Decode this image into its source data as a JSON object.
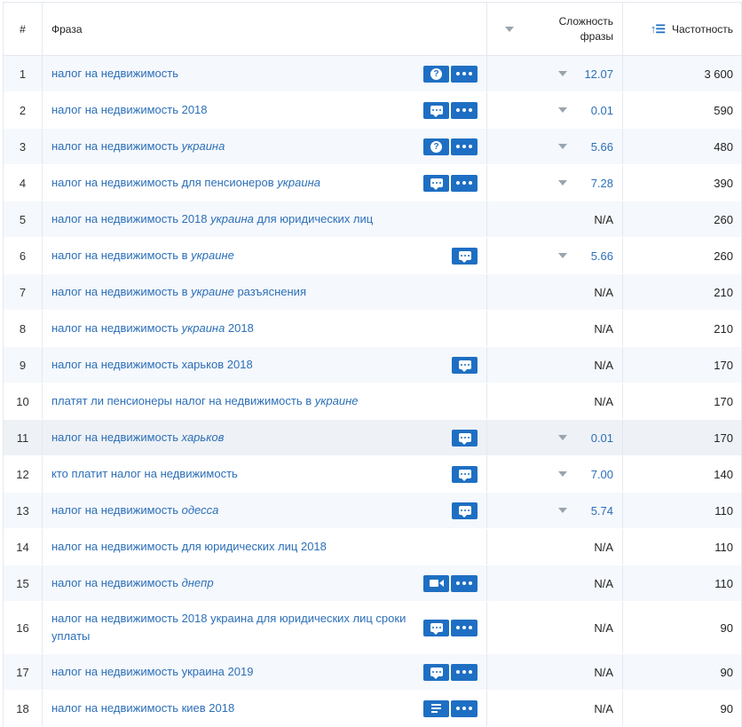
{
  "header": {
    "num": "#",
    "phrase": "Фраза",
    "difficulty_line1": "Сложность",
    "difficulty_line2": "фразы",
    "frequency": "Частотность"
  },
  "rows": [
    {
      "num": "1",
      "phrase": [
        {
          "t": "налог на недвижимость",
          "i": false
        }
      ],
      "buttons": [
        "question",
        "more"
      ],
      "difficulty": "12.07",
      "has_arrow": true,
      "frequency": "3 600"
    },
    {
      "num": "2",
      "phrase": [
        {
          "t": "налог на недвижимость 2018",
          "i": false
        }
      ],
      "buttons": [
        "chat",
        "more"
      ],
      "difficulty": "0.01",
      "has_arrow": true,
      "frequency": "590"
    },
    {
      "num": "3",
      "phrase": [
        {
          "t": "налог на недвижимость ",
          "i": false
        },
        {
          "t": "украина",
          "i": true
        }
      ],
      "buttons": [
        "question",
        "more"
      ],
      "difficulty": "5.66",
      "has_arrow": true,
      "frequency": "480"
    },
    {
      "num": "4",
      "phrase": [
        {
          "t": "налог на недвижимость для пенсионеров ",
          "i": false
        },
        {
          "t": "украина",
          "i": true
        }
      ],
      "buttons": [
        "chat",
        "more"
      ],
      "difficulty": "7.28",
      "has_arrow": true,
      "frequency": "390"
    },
    {
      "num": "5",
      "phrase": [
        {
          "t": "налог на недвижимость 2018 ",
          "i": false
        },
        {
          "t": "украина",
          "i": true
        },
        {
          "t": " для юридических лиц",
          "i": false
        }
      ],
      "buttons": [],
      "difficulty": "N/A",
      "has_arrow": false,
      "frequency": "260"
    },
    {
      "num": "6",
      "phrase": [
        {
          "t": "налог на недвижимость в ",
          "i": false
        },
        {
          "t": "украине",
          "i": true
        }
      ],
      "buttons": [
        "chat"
      ],
      "difficulty": "5.66",
      "has_arrow": true,
      "frequency": "260"
    },
    {
      "num": "7",
      "phrase": [
        {
          "t": "налог на недвижимость в ",
          "i": false
        },
        {
          "t": "украине",
          "i": true
        },
        {
          "t": " разъяснения",
          "i": false
        }
      ],
      "buttons": [],
      "difficulty": "N/A",
      "has_arrow": false,
      "frequency": "210"
    },
    {
      "num": "8",
      "phrase": [
        {
          "t": "налог на недвижимость ",
          "i": false
        },
        {
          "t": "украина",
          "i": true
        },
        {
          "t": " 2018",
          "i": false
        }
      ],
      "buttons": [],
      "difficulty": "N/A",
      "has_arrow": false,
      "frequency": "210"
    },
    {
      "num": "9",
      "phrase": [
        {
          "t": "налог на недвижимость харьков 2018",
          "i": false
        }
      ],
      "buttons": [
        "chat"
      ],
      "difficulty": "N/A",
      "has_arrow": false,
      "frequency": "170"
    },
    {
      "num": "10",
      "phrase": [
        {
          "t": "платят ли пенсионеры налог на недвижимость в ",
          "i": false
        },
        {
          "t": "украине",
          "i": true
        }
      ],
      "buttons": [],
      "difficulty": "N/A",
      "has_arrow": false,
      "frequency": "170"
    },
    {
      "num": "11",
      "phrase": [
        {
          "t": "налог на недвижимость ",
          "i": false
        },
        {
          "t": "харьков",
          "i": true
        }
      ],
      "buttons": [
        "chat"
      ],
      "difficulty": "0.01",
      "has_arrow": true,
      "frequency": "170"
    },
    {
      "num": "12",
      "phrase": [
        {
          "t": "кто платит налог на недвижимость",
          "i": false
        }
      ],
      "buttons": [
        "chat"
      ],
      "difficulty": "7.00",
      "has_arrow": true,
      "frequency": "140"
    },
    {
      "num": "13",
      "phrase": [
        {
          "t": "налог на недвижимость ",
          "i": false
        },
        {
          "t": "одесса",
          "i": true
        }
      ],
      "buttons": [
        "chat"
      ],
      "difficulty": "5.74",
      "has_arrow": true,
      "frequency": "110"
    },
    {
      "num": "14",
      "phrase": [
        {
          "t": "налог на недвижимость для юридических лиц 2018",
          "i": false
        }
      ],
      "buttons": [],
      "difficulty": "N/A",
      "has_arrow": false,
      "frequency": "110"
    },
    {
      "num": "15",
      "phrase": [
        {
          "t": "налог на недвижимость ",
          "i": false
        },
        {
          "t": "днепр",
          "i": true
        }
      ],
      "buttons": [
        "video",
        "more"
      ],
      "difficulty": "N/A",
      "has_arrow": false,
      "frequency": "110"
    },
    {
      "num": "16",
      "phrase": [
        {
          "t": "налог на недвижимость 2018 украина для юридических лиц сроки уплаты",
          "i": false
        }
      ],
      "buttons": [
        "chat",
        "more"
      ],
      "difficulty": "N/A",
      "has_arrow": false,
      "frequency": "90",
      "tall": true
    },
    {
      "num": "17",
      "phrase": [
        {
          "t": "налог на недвижимость украина 2019",
          "i": false
        }
      ],
      "buttons": [
        "chat",
        "more"
      ],
      "difficulty": "N/A",
      "has_arrow": false,
      "frequency": "90"
    },
    {
      "num": "18",
      "phrase": [
        {
          "t": "налог на недвижимость киев 2018",
          "i": false
        }
      ],
      "buttons": [
        "list",
        "more"
      ],
      "difficulty": "N/A",
      "has_arrow": false,
      "frequency": "90"
    }
  ]
}
